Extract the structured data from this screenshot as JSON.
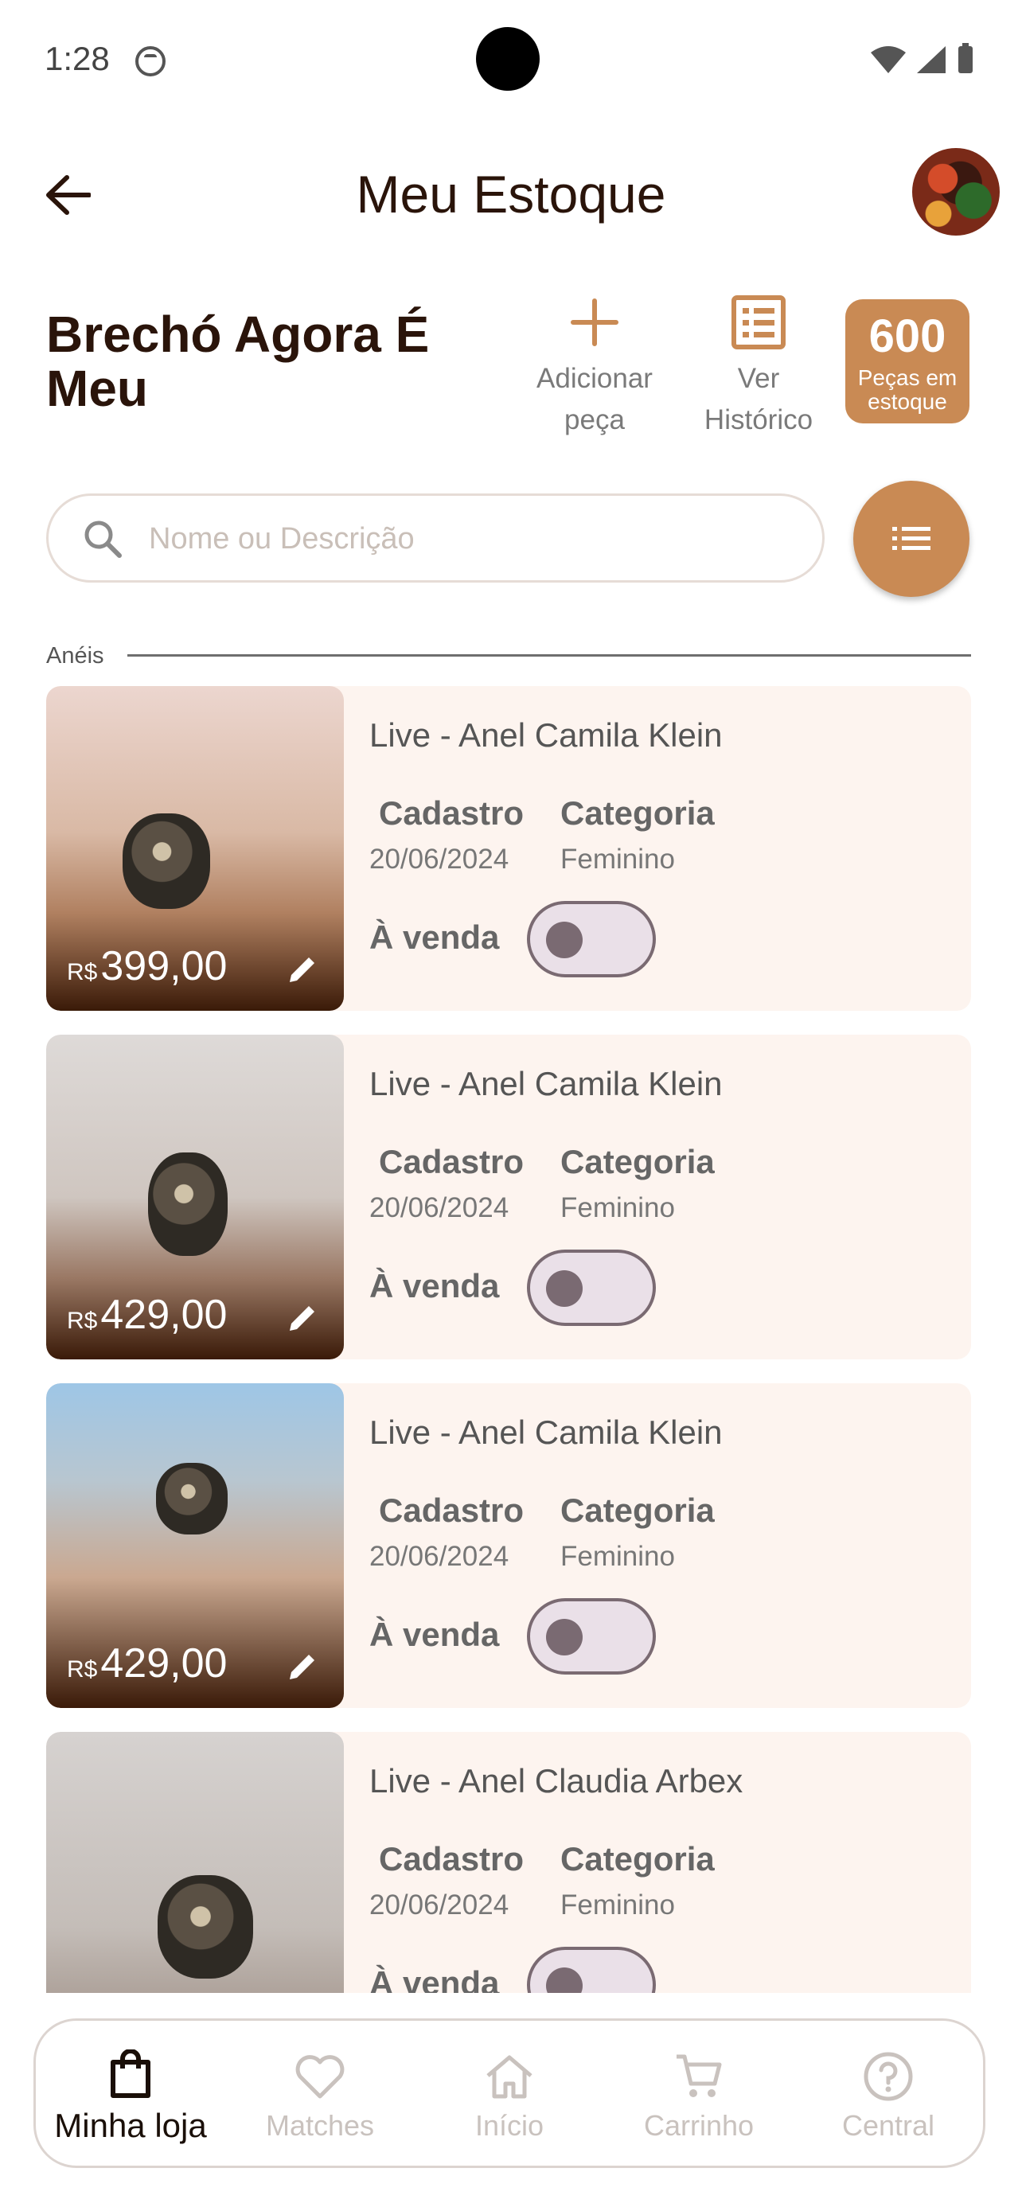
{
  "status": {
    "time": "1:28"
  },
  "header": {
    "title": "Meu Estoque"
  },
  "store": {
    "name": "Brechó Agora É Meu",
    "add_label": "Adicionar peça",
    "history_label": "Ver Histórico",
    "stock_count": "600",
    "stock_label": "Peças em estoque"
  },
  "search": {
    "placeholder": "Nome ou Descrição"
  },
  "section": {
    "label": "Anéis"
  },
  "items": [
    {
      "currency": "R$",
      "price": "399,00",
      "title": "Live - Anel Camila Klein",
      "cadastro_label": "Cadastro",
      "cadastro": "20/06/2024",
      "categoria_label": "Categoria",
      "categoria": "Feminino",
      "sale_label": "À venda",
      "on_sale": false
    },
    {
      "currency": "R$",
      "price": "429,00",
      "title": "Live - Anel Camila Klein",
      "cadastro_label": "Cadastro",
      "cadastro": "20/06/2024",
      "categoria_label": "Categoria",
      "categoria": "Feminino",
      "sale_label": "À venda",
      "on_sale": false
    },
    {
      "currency": "R$",
      "price": "429,00",
      "title": "Live - Anel Camila Klein",
      "cadastro_label": "Cadastro",
      "cadastro": "20/06/2024",
      "categoria_label": "Categoria",
      "categoria": "Feminino",
      "sale_label": "À venda",
      "on_sale": false
    },
    {
      "currency": "",
      "price": "",
      "title": "Live - Anel Claudia Arbex",
      "cadastro_label": "Cadastro",
      "cadastro": "20/06/2024",
      "categoria_label": "Categoria",
      "categoria": "Feminino",
      "sale_label": "À venda",
      "on_sale": false
    }
  ],
  "nav": {
    "items": [
      {
        "label": "Minha loja",
        "icon": "shopping-bag-icon",
        "active": true
      },
      {
        "label": "Matches",
        "icon": "heart-icon",
        "active": false
      },
      {
        "label": "Início",
        "icon": "home-icon",
        "active": false
      },
      {
        "label": "Carrinho",
        "icon": "cart-icon",
        "active": false
      },
      {
        "label": "Central",
        "icon": "help-circle-icon",
        "active": false
      }
    ]
  },
  "colors": {
    "accent": "#c98a54",
    "card_bg": "#fdf4ef",
    "title": "#2a140a"
  }
}
